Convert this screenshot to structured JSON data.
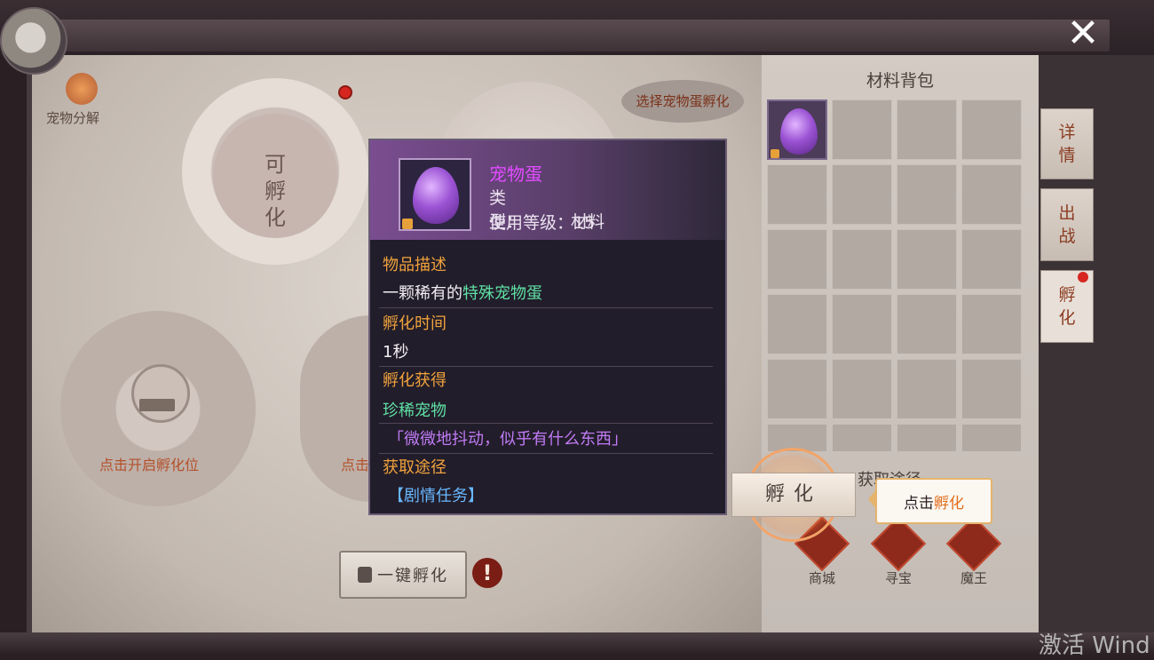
{
  "header": {
    "close_icon": "close-icon"
  },
  "left": {
    "decompose_label": "宠物分解",
    "slot1_text": "可孵化",
    "slot3_label": "点击开启孵化位",
    "slot4_label": "点击",
    "select_bubble": "选择宠物蛋孵化",
    "one_key_label": "一键孵化",
    "warn_symbol": "!"
  },
  "bag": {
    "title": "材料背包",
    "obtain_label": "获取途径",
    "sources": [
      {
        "label": "商城"
      },
      {
        "label": "寻宝"
      },
      {
        "label": "魔王"
      }
    ]
  },
  "side_tabs": [
    {
      "label": "详情"
    },
    {
      "label": "出战"
    },
    {
      "label": "孵化"
    }
  ],
  "hatch": {
    "button_label": "孵化",
    "hint_prefix": "点击",
    "hint_accent": "孵化"
  },
  "tooltip": {
    "name": "宠物蛋",
    "type_label": "类　　型：",
    "type_value": "材料",
    "level_label": "使用等级：",
    "level_value": "15",
    "desc_title": "物品描述",
    "desc_prefix": "一颗稀有的",
    "desc_highlight": "特殊宠物蛋",
    "time_title": "孵化时间",
    "time_value": "1秒",
    "reward_title": "孵化获得",
    "reward_value": "珍稀宠物",
    "flavor": "「微微地抖动，似乎有什么东西」",
    "source_title": "获取途径",
    "source_value": "【剧情任务】"
  },
  "watermark": "激活 Wind",
  "colors": {
    "accent_orange": "#f0a23c",
    "highlight_green": "#5fe0a4",
    "item_purple": "#e24cff",
    "source_blue": "#69b8ff",
    "alert_red": "#d6261f"
  }
}
